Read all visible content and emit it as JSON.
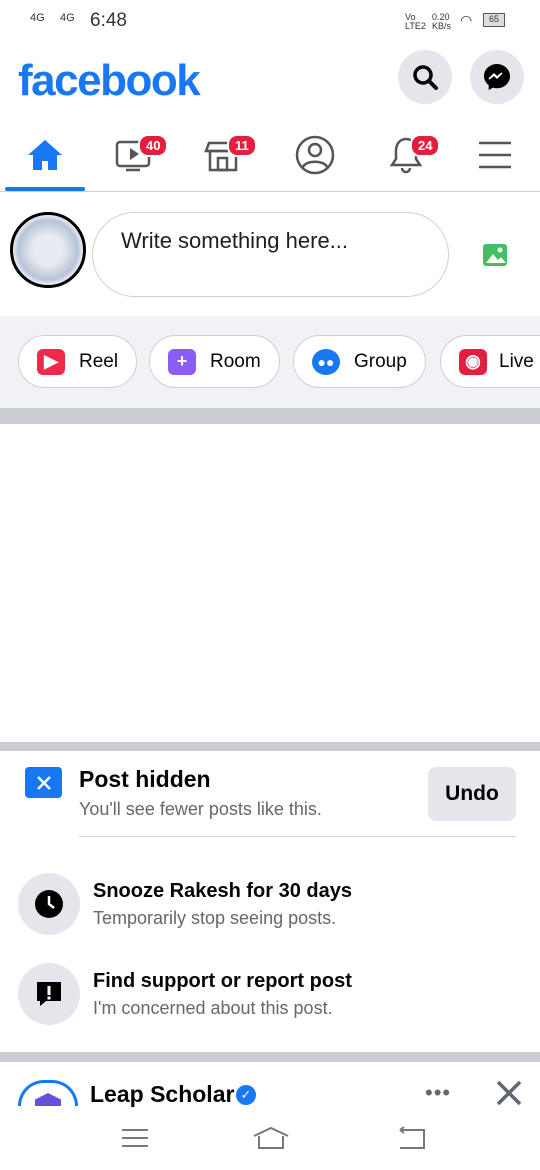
{
  "status": {
    "net1": "4G",
    "net2": "4G",
    "time": "6:48",
    "volte": "Vo LTE2",
    "speed": "0.20 KB/s",
    "battery": "65"
  },
  "header": {
    "logo": "facebook"
  },
  "tabs": [
    {
      "name": "home",
      "badge": ""
    },
    {
      "name": "watch",
      "badge": "40"
    },
    {
      "name": "marketplace",
      "badge": "11"
    },
    {
      "name": "profile",
      "badge": ""
    },
    {
      "name": "notifications",
      "badge": "24"
    },
    {
      "name": "menu",
      "badge": ""
    }
  ],
  "composer": {
    "placeholder": "Write something here..."
  },
  "chips": [
    {
      "label": "Reel",
      "color": "#f02849"
    },
    {
      "label": "Room",
      "color": "#8b5cf6"
    },
    {
      "label": "Group",
      "color": "#1877f2"
    },
    {
      "label": "Live",
      "color": "#e41e3f"
    }
  ],
  "hidden": {
    "title": "Post hidden",
    "subtitle": "You'll see fewer posts like this.",
    "undo": "Undo"
  },
  "options": [
    {
      "title": "Snooze Rakesh for 30 days",
      "subtitle": "Temporarily stop seeing posts.",
      "icon": "clock-icon"
    },
    {
      "title": "Find support or report post",
      "subtitle": "I'm concerned about this post.",
      "icon": "report-icon"
    }
  ],
  "next_post": {
    "author": "Leap Scholar",
    "verified": true
  },
  "colors": {
    "brand": "#1877f2",
    "badge": "#e41e3f"
  }
}
